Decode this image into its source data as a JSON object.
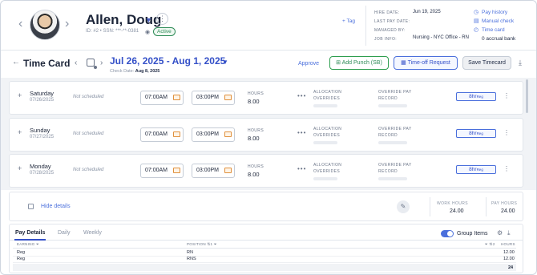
{
  "employee": {
    "name": "Allen, Doug",
    "id_ssn": "ID: #2 • SSN: ***-**-0381",
    "status": "Active",
    "tag_label": "+ Tag"
  },
  "info": {
    "hire_date_label": "HIRE DATE:",
    "hire_date": "Jun 19, 2025",
    "last_pay_date_label": "LAST PAY DATE:",
    "managed_by_label": "MANAGED BY:",
    "job_info_label": "JOB INFO:",
    "job_info": "Nursing - NYC Office - RN"
  },
  "side_links": {
    "pay_history": "Pay history",
    "manual_check": "Manual check",
    "time_card": "Time card",
    "accrual_bank": "0 accrual bank"
  },
  "timecard": {
    "title": "Time Card",
    "date_range": "Jul 26, 2025 - Aug 1, 2025",
    "check_date_label": "Check Date:",
    "check_date": "Aug 8, 2025",
    "approve": "Approve",
    "add_punch": "Add Punch (SB)",
    "time_off": "Time-off Request",
    "save": "Save Timecard"
  },
  "labels": {
    "hours": "HOURS",
    "allocation": "ALLOCATION",
    "overrides": "OVERRIDES",
    "override_pay": "OVERRIDE PAY",
    "record": "RECORD",
    "not_scheduled": "Not scheduled",
    "hr_suffix": "hr",
    "reg": "Reg"
  },
  "days": [
    {
      "name": "Saturday",
      "date": "07/26/2025",
      "in": "07:00AM",
      "out": "03:00PM",
      "hours": "8.00",
      "pill_hours": "8"
    },
    {
      "name": "Sunday",
      "date": "07/27/2025",
      "in": "07:00AM",
      "out": "03:00PM",
      "hours": "8.00",
      "pill_hours": "8"
    },
    {
      "name": "Monday",
      "date": "07/28/2025",
      "in": "07:00AM",
      "out": "03:00PM",
      "hours": "8.00",
      "pill_hours": "8"
    }
  ],
  "summary": {
    "hide_details": "Hide details",
    "work_hours_label": "WORK HOURS",
    "work_hours": "24.00",
    "pay_hours_label": "PAY HOURS",
    "pay_hours": "24.00"
  },
  "pay_details": {
    "tabs": [
      "Pay Details",
      "Daily",
      "Weekly"
    ],
    "group_items": "Group Items",
    "group_items_on": true,
    "col_earning": "EARNING",
    "col_position": "POSITION",
    "col_position_sort": "1",
    "col_hours_sort": "2",
    "col_hours": "HOURS",
    "rows": [
      {
        "earning": "Reg",
        "position": "RN",
        "hours": "12.00"
      },
      {
        "earning": "Reg",
        "position": "RNS",
        "hours": "12.00"
      }
    ],
    "total": "24"
  },
  "colors": {
    "accent": "#3450c8",
    "link": "#4a6fdc",
    "success": "#2e8b57",
    "time_icon": "#e0903c"
  }
}
